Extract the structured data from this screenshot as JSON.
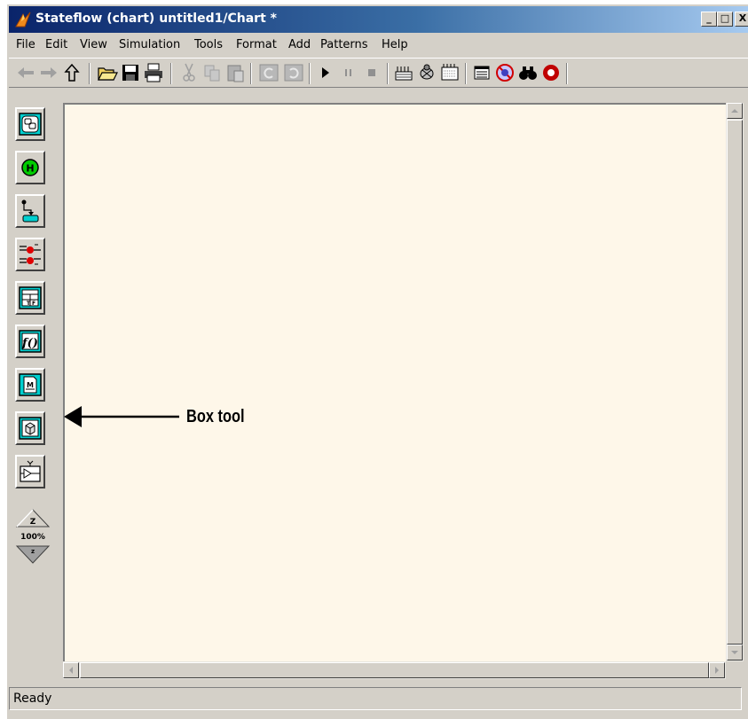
{
  "window": {
    "title": "Stateflow (chart) untitled1/Chart *",
    "caption_minimize": "_",
    "caption_maximize": "□",
    "caption_close": "X"
  },
  "menu": {
    "items": [
      "File",
      "Edit",
      "View",
      "Simulation",
      "Tools",
      "Format",
      "Add",
      "Patterns",
      "Help"
    ]
  },
  "toolbar": {
    "buttons": [
      "back-icon",
      "forward-icon",
      "up-icon",
      "open-icon",
      "save-icon",
      "print-icon",
      "cut-icon",
      "copy-icon",
      "paste-icon",
      "undo-icon",
      "redo-icon",
      "play-icon",
      "pause-icon",
      "stop-icon",
      "build-icon",
      "debug-icon",
      "parameters-icon",
      "explorer-icon",
      "target-icon",
      "find-icon",
      "breakpoint-icon"
    ]
  },
  "palette": {
    "tools": [
      "state-tool",
      "history-junction-tool",
      "default-transition-tool",
      "connective-junction-tool",
      "truth-table-tool",
      "graphical-function-tool",
      "embedded-function-tool",
      "box-tool",
      "simulink-function-tool"
    ],
    "zoom_label": "100%"
  },
  "annotation": {
    "label": "Box tool"
  },
  "status": {
    "text": "Ready"
  },
  "colors": {
    "canvas": "#fef7e9",
    "chrome": "#d4d0c8",
    "titlebar_start": "#0a246a",
    "titlebar_end": "#a6caf0"
  }
}
